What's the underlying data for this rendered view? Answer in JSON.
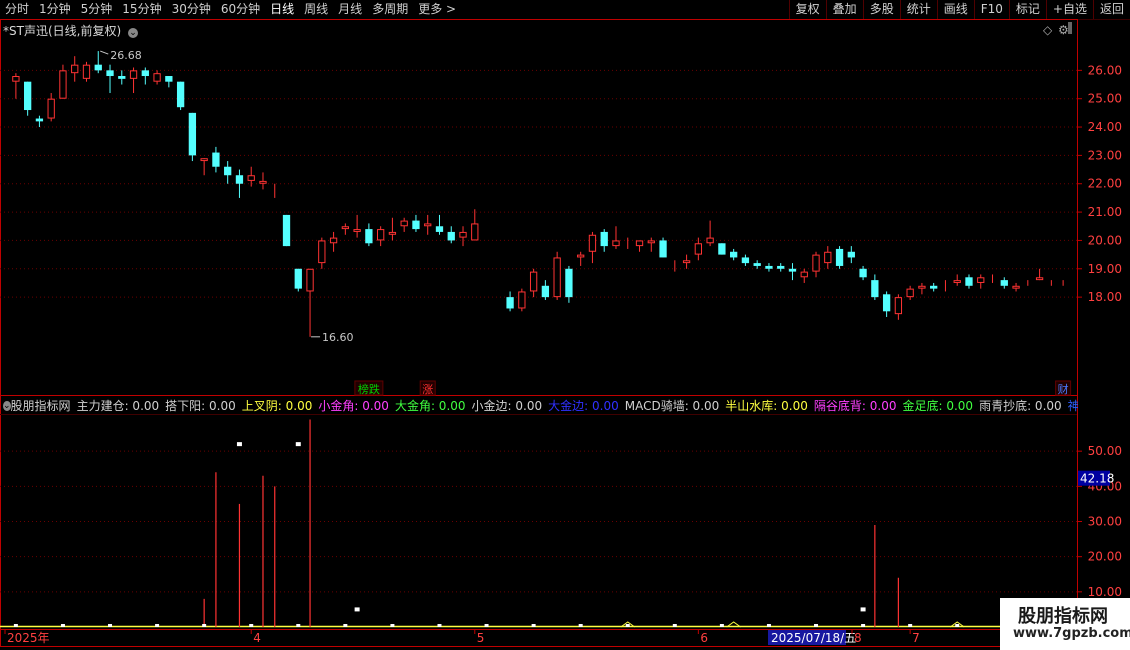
{
  "toolbar": {
    "left": [
      {
        "label": "分时"
      },
      {
        "label": "1分钟"
      },
      {
        "label": "5分钟"
      },
      {
        "label": "15分钟"
      },
      {
        "label": "30分钟"
      },
      {
        "label": "60分钟"
      },
      {
        "label": "日线",
        "active": true
      },
      {
        "label": "周线"
      },
      {
        "label": "月线"
      },
      {
        "label": "多周期"
      },
      {
        "label": "更多 >"
      }
    ],
    "right": [
      {
        "label": "复权"
      },
      {
        "label": "叠加"
      },
      {
        "label": "多股"
      },
      {
        "label": "统计"
      },
      {
        "label": "画线"
      },
      {
        "label": "F10"
      },
      {
        "label": "标记"
      },
      {
        "label": "+自选"
      },
      {
        "label": "返回"
      }
    ]
  },
  "chart": {
    "title": "*ST声迅(日线,前复权)",
    "high_label": "26.68",
    "low_label": "16.60",
    "badges": [
      {
        "text": "榜跌",
        "color": "#00d000",
        "idx": 30
      },
      {
        "text": "涨",
        "color": "#ff3030",
        "idx": 35
      },
      {
        "text": "财",
        "color": "#4a7aff",
        "idx": 89
      }
    ]
  },
  "indicator": {
    "items": [
      {
        "label": "股朋指标网",
        "value": "",
        "color": "#d0d0d0"
      },
      {
        "label": "主力建仓",
        "value": "0.00",
        "color": "#d0d0d0"
      },
      {
        "label": "搭下阳",
        "value": "0.00",
        "color": "#d0d0d0"
      },
      {
        "label": "上叉阴",
        "value": "0.00",
        "color": "#ffff40"
      },
      {
        "label": "小金角",
        "value": "0.00",
        "color": "#ff40ff"
      },
      {
        "label": "大金角",
        "value": "0.00",
        "color": "#40ff40"
      },
      {
        "label": "小金边",
        "value": "0.00",
        "color": "#d0d0d0"
      },
      {
        "label": "大金边",
        "value": "0.00",
        "color": "#3030ff"
      },
      {
        "label": "MACD骑墙",
        "value": "0.00",
        "color": "#d0d0d0"
      },
      {
        "label": "半山水库",
        "value": "0.00",
        "color": "#ffff40"
      },
      {
        "label": "隔谷底背",
        "value": "0.00",
        "color": "#ff40ff"
      },
      {
        "label": "金足底",
        "value": "0.00",
        "color": "#40ff40"
      },
      {
        "label": "雨青抄底",
        "value": "0.00",
        "color": "#d0d0d0"
      },
      {
        "label": "神舒深涨嘴",
        "value": "",
        "color": "#3060ff"
      }
    ],
    "current_value": "42.18"
  },
  "axis": {
    "months": [
      "2025年",
      "4",
      "5",
      "6",
      "7",
      "2025/07/18/五",
      "8"
    ]
  },
  "watermark": {
    "title": "股朋指标网",
    "url": "www.7gpzb.com"
  },
  "colors": {
    "up": "#ff3333",
    "down": "#54ffff",
    "grid": "#6a0000",
    "axis": "#c00000",
    "label": "#ff4040",
    "line": "#ffff40"
  },
  "chart_data": {
    "type": "candlestick",
    "title": "*ST声迅(日线,前复权)",
    "price_ylim": [
      15.5,
      27.0
    ],
    "price_ticks": [
      18.0,
      19.0,
      20.0,
      21.0,
      22.0,
      23.0,
      24.0,
      25.0,
      26.0
    ],
    "indicator_ylim": [
      0,
      60
    ],
    "indicator_ticks": [
      10,
      20,
      30,
      40,
      50
    ],
    "candles": [
      [
        25.6,
        25.9,
        25.0,
        25.8
      ],
      [
        25.6,
        25.6,
        24.4,
        24.6
      ],
      [
        24.3,
        24.4,
        24.0,
        24.2
      ],
      [
        24.3,
        25.2,
        24.2,
        25.0
      ],
      [
        25.0,
        26.2,
        25.0,
        26.0
      ],
      [
        25.9,
        26.5,
        25.6,
        26.2
      ],
      [
        25.7,
        26.3,
        25.6,
        26.2
      ],
      [
        26.2,
        26.68,
        25.9,
        26.0
      ],
      [
        26.0,
        26.2,
        25.2,
        25.8
      ],
      [
        25.8,
        26.0,
        25.5,
        25.7
      ],
      [
        25.7,
        26.1,
        25.2,
        26.0
      ],
      [
        26.0,
        26.1,
        25.5,
        25.8
      ],
      [
        25.6,
        26.0,
        25.5,
        25.9
      ],
      [
        25.8,
        25.8,
        25.4,
        25.6
      ],
      [
        25.6,
        25.6,
        24.6,
        24.7
      ],
      [
        24.5,
        24.5,
        22.8,
        23.0
      ],
      [
        22.8,
        22.9,
        22.3,
        22.9
      ],
      [
        23.1,
        23.3,
        22.4,
        22.6
      ],
      [
        22.6,
        22.8,
        22.0,
        22.3
      ],
      [
        22.3,
        22.5,
        21.5,
        22.0
      ],
      [
        22.1,
        22.6,
        21.9,
        22.3
      ],
      [
        22.0,
        22.4,
        21.8,
        22.1
      ],
      [
        21.8,
        22.0,
        21.5,
        21.8
      ],
      [
        20.9,
        20.9,
        19.8,
        19.8
      ],
      [
        19.0,
        19.0,
        18.2,
        18.3
      ],
      [
        18.2,
        19.0,
        16.6,
        19.0
      ],
      [
        19.2,
        20.1,
        19.0,
        20.0
      ],
      [
        19.9,
        20.3,
        19.6,
        20.1
      ],
      [
        20.4,
        20.6,
        20.2,
        20.5
      ],
      [
        20.3,
        20.9,
        20.1,
        20.4
      ],
      [
        20.4,
        20.6,
        19.8,
        19.9
      ],
      [
        20.0,
        20.5,
        19.8,
        20.4
      ],
      [
        20.2,
        20.8,
        20.0,
        20.3
      ],
      [
        20.5,
        20.8,
        20.3,
        20.7
      ],
      [
        20.7,
        20.9,
        20.3,
        20.4
      ],
      [
        20.5,
        20.9,
        20.2,
        20.6
      ],
      [
        20.5,
        20.9,
        20.2,
        20.3
      ],
      [
        20.3,
        20.5,
        19.9,
        20.0
      ],
      [
        20.1,
        20.5,
        19.8,
        20.3
      ],
      [
        20.0,
        21.1,
        20.0,
        20.6
      ],
      [
        19.4,
        19.4,
        19.4,
        19.4
      ],
      [
        18.4,
        18.4,
        18.4,
        18.4
      ],
      [
        18.0,
        18.2,
        17.5,
        17.6
      ],
      [
        17.6,
        18.3,
        17.5,
        18.2
      ],
      [
        18.2,
        19.0,
        18.0,
        18.9
      ],
      [
        18.4,
        18.6,
        17.9,
        18.0
      ],
      [
        18.0,
        19.6,
        17.9,
        19.4
      ],
      [
        19.0,
        19.1,
        17.8,
        18.0
      ],
      [
        19.4,
        19.6,
        19.1,
        19.5
      ],
      [
        19.6,
        20.3,
        19.2,
        20.2
      ],
      [
        20.3,
        20.4,
        19.6,
        19.8
      ],
      [
        19.8,
        20.5,
        19.7,
        20.0
      ],
      [
        19.9,
        20.1,
        19.7,
        19.9
      ],
      [
        19.8,
        20.0,
        19.6,
        20.0
      ],
      [
        19.9,
        20.1,
        19.6,
        20.0
      ],
      [
        20.0,
        20.1,
        19.4,
        19.4
      ],
      [
        19.1,
        19.3,
        18.9,
        19.1
      ],
      [
        19.2,
        19.5,
        19.0,
        19.3
      ],
      [
        19.5,
        20.1,
        19.3,
        19.9
      ],
      [
        19.9,
        20.7,
        19.8,
        20.1
      ],
      [
        19.9,
        19.9,
        19.5,
        19.5
      ],
      [
        19.6,
        19.7,
        19.3,
        19.4
      ],
      [
        19.4,
        19.5,
        19.1,
        19.2
      ],
      [
        19.2,
        19.3,
        19.0,
        19.1
      ],
      [
        19.1,
        19.2,
        18.9,
        19.0
      ],
      [
        19.1,
        19.2,
        18.9,
        19.0
      ],
      [
        19.0,
        19.2,
        18.6,
        18.9
      ],
      [
        18.7,
        19.0,
        18.5,
        18.9
      ],
      [
        18.9,
        19.6,
        18.7,
        19.5
      ],
      [
        19.2,
        19.8,
        19.0,
        19.6
      ],
      [
        19.7,
        19.8,
        19.0,
        19.1
      ],
      [
        19.6,
        19.8,
        19.2,
        19.4
      ],
      [
        19.0,
        19.1,
        18.6,
        18.7
      ],
      [
        18.6,
        18.8,
        17.9,
        18.0
      ],
      [
        18.1,
        18.2,
        17.3,
        17.5
      ],
      [
        17.4,
        18.1,
        17.2,
        18.0
      ],
      [
        18.0,
        18.4,
        17.9,
        18.3
      ],
      [
        18.3,
        18.5,
        18.1,
        18.4
      ],
      [
        18.4,
        18.5,
        18.2,
        18.3
      ],
      [
        18.5,
        18.6,
        18.2,
        18.5
      ],
      [
        18.5,
        18.8,
        18.4,
        18.6
      ],
      [
        18.7,
        18.8,
        18.3,
        18.4
      ],
      [
        18.5,
        18.8,
        18.3,
        18.7
      ],
      [
        18.6,
        18.8,
        18.5,
        18.6
      ],
      [
        18.6,
        18.7,
        18.3,
        18.4
      ],
      [
        18.3,
        18.5,
        18.2,
        18.4
      ],
      [
        18.5,
        18.6,
        18.4,
        18.5
      ],
      [
        18.6,
        19.0,
        18.6,
        18.7
      ],
      [
        18.5,
        18.6,
        18.4,
        18.5
      ],
      [
        18.5,
        18.6,
        18.4,
        18.5
      ]
    ],
    "volumes": [
      0,
      0,
      0,
      0,
      0,
      0,
      0,
      0,
      0,
      0,
      0,
      0,
      0,
      0,
      0,
      0,
      8,
      44,
      0,
      35,
      0,
      43,
      40,
      0,
      0,
      59,
      0,
      0,
      0,
      0,
      0,
      0,
      0,
      0,
      0,
      0,
      0,
      0,
      0,
      0,
      0,
      0,
      0,
      0,
      0,
      0,
      0,
      0,
      0,
      0,
      0,
      0,
      0,
      0,
      0,
      0,
      0,
      0,
      0,
      0,
      0,
      0,
      0,
      0,
      0,
      0,
      0,
      0,
      0,
      0,
      0,
      0,
      0,
      29,
      0,
      14,
      0,
      0,
      0,
      0,
      0,
      0,
      0,
      0,
      0,
      0,
      0,
      0,
      0,
      0,
      0
    ]
  }
}
